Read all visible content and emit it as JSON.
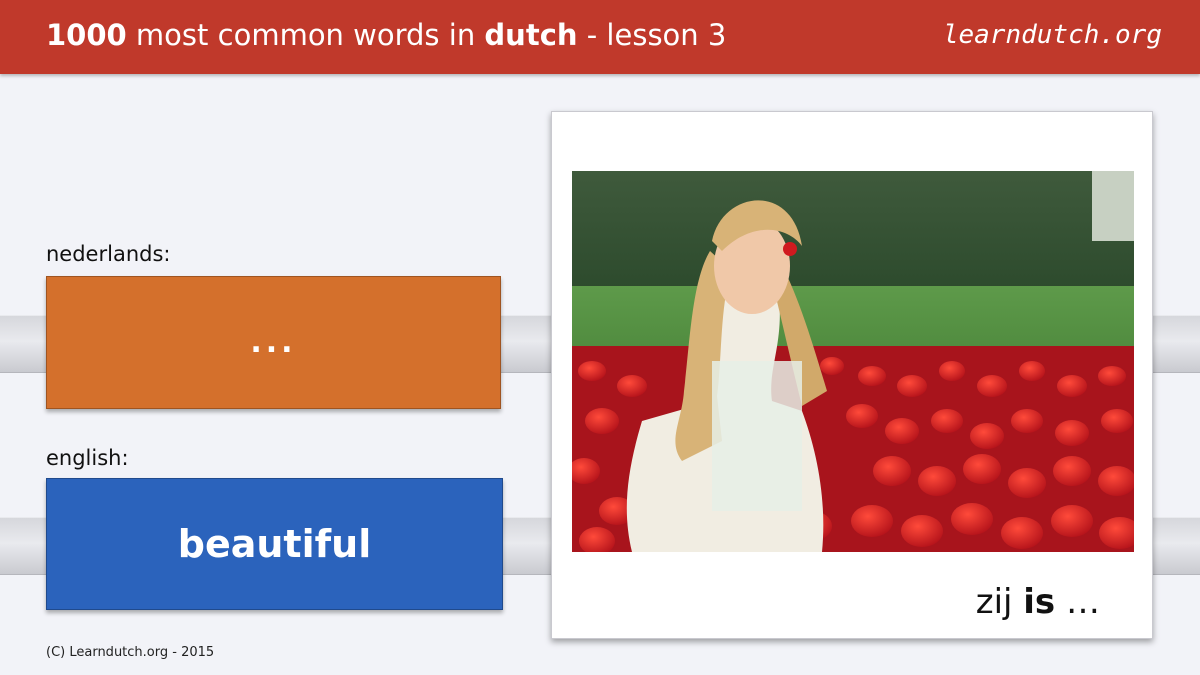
{
  "header": {
    "title_num": "1000",
    "title_mid": " most common words in ",
    "title_lang": "dutch",
    "title_end": " - lesson 3",
    "site": "learndutch.org"
  },
  "dutch": {
    "label": "nederlands:",
    "word": "..."
  },
  "english": {
    "label": "english:",
    "word": "beautiful"
  },
  "photo": {
    "caption_pre": "zij ",
    "caption_bold": "is",
    "caption_post": " …"
  },
  "footer": {
    "copyright": "(C) Learndutch.org - 2015"
  },
  "colors": {
    "header": "#c0392b",
    "dutch_card": "#d4702c",
    "english_card": "#2b63bc",
    "background": "#f2f3f8"
  }
}
